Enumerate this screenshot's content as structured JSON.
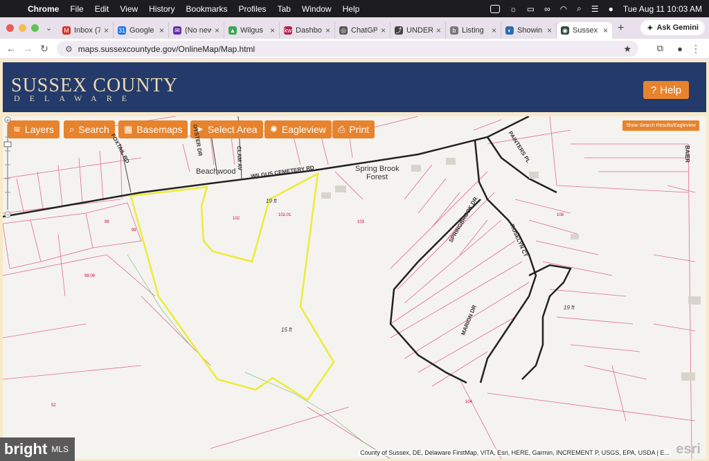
{
  "menubar": {
    "app": "Chrome",
    "items": [
      "File",
      "Edit",
      "View",
      "History",
      "Bookmarks",
      "Profiles",
      "Tab",
      "Window",
      "Help"
    ],
    "clock": "Tue Aug 11  10:03 AM"
  },
  "tabs": [
    {
      "label": "Inbox (7",
      "color": "#d93025",
      "glyph": "M"
    },
    {
      "label": "Google",
      "color": "#1a73e8",
      "glyph": "31"
    },
    {
      "label": "(No new",
      "color": "#6b2fa8",
      "glyph": "✉"
    },
    {
      "label": "Wilgus",
      "color": "#34a853",
      "glyph": "▲"
    },
    {
      "label": "Dashbo",
      "color": "#b0224d",
      "glyph": "kw"
    },
    {
      "label": "ChatGP",
      "color": "#555555",
      "glyph": "◎"
    },
    {
      "label": "UNDER",
      "color": "#444444",
      "glyph": "⤴"
    },
    {
      "label": "Listing",
      "color": "#777777",
      "glyph": "b"
    },
    {
      "label": "Showin",
      "color": "#2b6cb0",
      "glyph": "◐"
    },
    {
      "label": "Sussex",
      "color": "#2e4a3a",
      "glyph": "◉",
      "active": true
    }
  ],
  "gemini_label": "Ask Gemini",
  "address": {
    "url": "maps.sussexcountyde.gov/OnlineMap/Map.html"
  },
  "site": {
    "brand_top": "SUSSEX COUNTY",
    "brand_bottom": "DELAWARE",
    "help_label": "Help"
  },
  "toolbar": {
    "layers": "Layers",
    "search": "Search",
    "basemaps": "Basemaps",
    "select_area": "Select Area",
    "eagleview": "Eagleview",
    "print": "Print",
    "show_results": "Show Search Results/Eagleview"
  },
  "map": {
    "places": {
      "beachwood": "Beachwood",
      "spring_brook": "Spring Brook",
      "forest": "Forest"
    },
    "roads": {
      "wilgus": "WILGUS CEMETERY RD",
      "foxtail": "FOXTAIL RD",
      "oyster": "OYSTER DR",
      "clam": "CLAM AV",
      "painters": "PAINTERS PL",
      "springbrook": "SPRINGBROOK DR",
      "roselyn": "ROSELYN CT",
      "marion": "MARION DR",
      "baier": "BAIER"
    },
    "elevations": {
      "e1": "19 ft",
      "e2": "15 ft",
      "e3": "19 ft"
    },
    "parcels": {
      "p1": "102",
      "p2": "102.01",
      "p3": "103",
      "p4": "98",
      "p5": "99",
      "p6": "98.08",
      "p7": "104",
      "p8": "108",
      "p9": "52"
    },
    "attribution": "County of Sussex, DE, Delaware FirstMap, VITA, Esri, HERE, Garmin, INCREMENT P, USGS, EPA, USDA | E...",
    "esri": "esri"
  },
  "watermark": {
    "brand": "bright",
    "suffix": "MLS"
  }
}
